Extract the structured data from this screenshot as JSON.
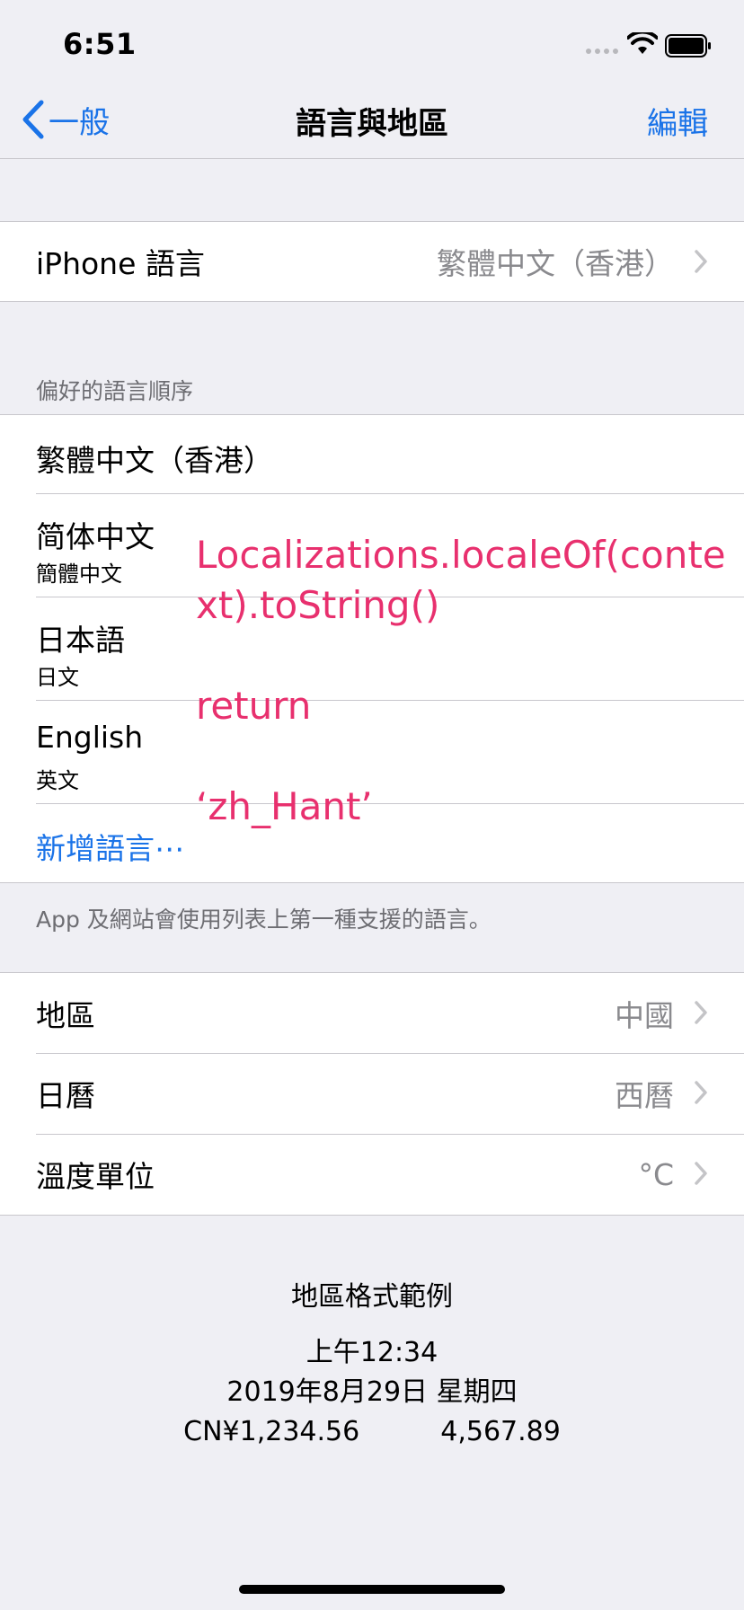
{
  "status_bar": {
    "time": "6:51"
  },
  "nav": {
    "back_label": "一般",
    "title": "語言與地區",
    "edit_label": "編輯"
  },
  "iphone_language": {
    "label": "iPhone 語言",
    "value": "繁體中文（香港）"
  },
  "preferred_languages": {
    "header": "偏好的語言順序",
    "items": [
      {
        "main": "繁體中文（香港）",
        "sub": ""
      },
      {
        "main": "简体中文",
        "sub": "簡體中文"
      },
      {
        "main": "日本語",
        "sub": "日文"
      },
      {
        "main": "English",
        "sub": "英文"
      }
    ],
    "add_label": "新增語言⋯",
    "footer": "App 及網站會使用列表上第一種支援的語言。"
  },
  "region_settings": {
    "items": [
      {
        "label": "地區",
        "value": "中國"
      },
      {
        "label": "日曆",
        "value": "西曆"
      },
      {
        "label": "溫度單位",
        "value": "°C"
      }
    ]
  },
  "format_example": {
    "title": "地區格式範例",
    "time": "上午12:34",
    "date": "2019年8月29日 星期四",
    "currency": "CN¥1,234.56",
    "number": "4,567.89"
  },
  "overlay": {
    "line1": "Localizations.localeOf(context).toString()",
    "line2": "return",
    "line3": "‘zh_Hant’"
  },
  "colors": {
    "accent": "#1a73e8",
    "overlay_text": "#e8306e",
    "background": "#efeff4"
  }
}
